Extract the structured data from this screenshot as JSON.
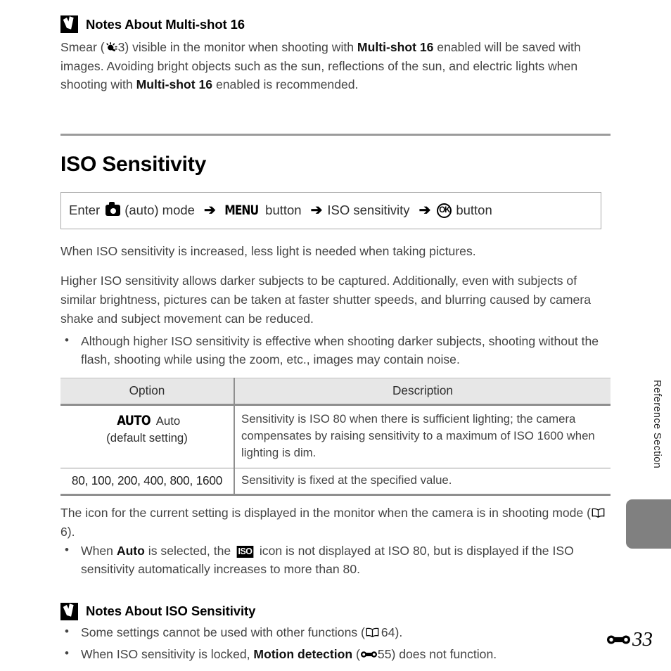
{
  "document": {
    "page_label": "33",
    "section_marker_icon": "reference-section-icon",
    "side_tab_label": "Reference Section"
  },
  "top_note": {
    "icon": "caution-check-icon",
    "title": "Notes About Multi-shot 16",
    "paragraph_part1": "Smear (",
    "bulb_icon": "smear-bulb-icon",
    "paragraph_ref": "3",
    "paragraph_part2": ") visible in the monitor when shooting with ",
    "bold1": "Multi-shot 16",
    "paragraph_part3": " enabled will be saved with images. Avoiding bright objects such as the sun, reflections of the sun, and electric lights when shooting with ",
    "bold2": "Multi-shot 16",
    "paragraph_part4": " enabled is recommended."
  },
  "section": {
    "title": "ISO Sensitivity"
  },
  "instruction": {
    "enter_label": "Enter",
    "camera_icon": "camera-auto-mode-icon",
    "mode_label": "(auto) mode",
    "arrow": "➔",
    "menu_glyph": "MENU",
    "menu_button_label": "button",
    "iso_sensitivity_label": "ISO sensitivity",
    "ok_glyph": "OK",
    "ok_button_label": "button"
  },
  "body": {
    "para1": "When ISO sensitivity is increased, less light is needed when taking pictures.",
    "para2": "Higher ISO sensitivity allows darker subjects to be captured. Additionally, even with subjects of similar brightness, pictures can be taken at faster shutter speeds, and blurring caused by camera shake and subject movement can be reduced.",
    "bullet1": "Although higher ISO sensitivity is effective when shooting darker subjects, shooting without the flash, shooting while using the zoom, etc., images may contain noise."
  },
  "table": {
    "headers": {
      "option": "Option",
      "description": "Description"
    },
    "rows": [
      {
        "option_glyph": "AUTO",
        "option_label": "Auto",
        "option_sub": "(default setting)",
        "description": "Sensitivity is ISO 80 when there is sufficient lighting; the camera compensates by raising sensitivity to a maximum of ISO 1600 when lighting is dim."
      },
      {
        "option_values": "80, 100, 200, 400, 800, 1600",
        "description": "Sensitivity is fixed at the specified value."
      }
    ]
  },
  "after_table": {
    "para_part1": "The icon for the current setting is displayed in the monitor when the camera is in shooting mode (",
    "book_icon": "book-reference-icon",
    "page_ref": "6",
    "para_part2": ").",
    "bullet_part1": "When ",
    "bullet_bold": "Auto",
    "bullet_part2": " is selected, the ",
    "iso_icon_label": "ISO",
    "bullet_part3": " icon is not displayed at ISO 80, but is displayed if the ISO sensitivity automatically increases to more than 80."
  },
  "bottom_note": {
    "icon": "caution-check-icon",
    "title": "Notes About ISO Sensitivity",
    "bullets": [
      {
        "part1": "Some settings cannot be used with other functions (",
        "icon": "book-reference-icon",
        "ref": "64",
        "part2": ")."
      },
      {
        "part1": "When ISO sensitivity is locked, ",
        "bold": "Motion detection",
        "part2": " (",
        "icon": "reference-section-icon",
        "ref": "55",
        "part3": ") does not function."
      }
    ]
  },
  "colors": {
    "text": "#444444",
    "heading": "#000000",
    "rule": "#9b9b9b",
    "table_header_bg": "#e7e7e7",
    "side_tab": "#808080"
  }
}
